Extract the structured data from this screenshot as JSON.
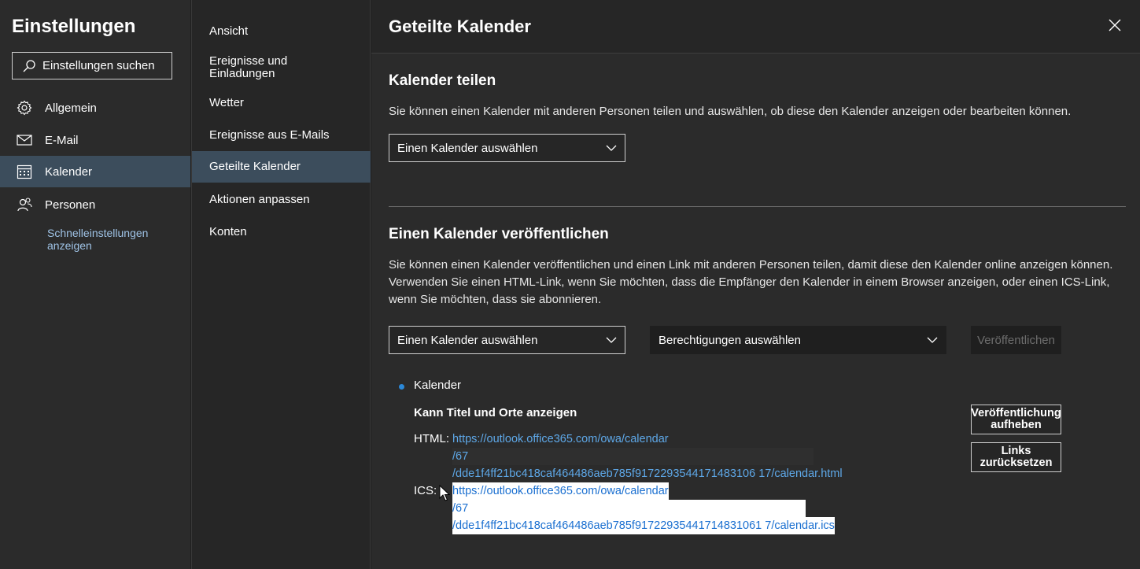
{
  "sidebar": {
    "title": "Einstellungen",
    "search_placeholder": "Einstellungen suchen",
    "items": [
      {
        "label": "Allgemein",
        "icon": "gear-icon"
      },
      {
        "label": "E-Mail",
        "icon": "mail-icon"
      },
      {
        "label": "Kalender",
        "icon": "calendar-icon"
      },
      {
        "label": "Personen",
        "icon": "people-icon"
      }
    ],
    "quick_settings": "Schnelleinstellungen anzeigen"
  },
  "subnav": {
    "items": [
      {
        "label": "Ansicht"
      },
      {
        "label": "Ereignisse und Einladungen"
      },
      {
        "label": "Wetter"
      },
      {
        "label": "Ereignisse aus E-Mails"
      },
      {
        "label": "Geteilte Kalender"
      },
      {
        "label": "Aktionen anpassen"
      },
      {
        "label": "Konten"
      }
    ]
  },
  "panel": {
    "title": "Geteilte Kalender",
    "share": {
      "title": "Kalender teilen",
      "description": "Sie können einen Kalender mit anderen Personen teilen und auswählen, ob diese den Kalender anzeigen oder bearbeiten können.",
      "calendar_select": "Einen Kalender auswählen"
    },
    "publish": {
      "title": "Einen Kalender veröffentlichen",
      "description": "Sie können einen Kalender veröffentlichen und einen Link mit anderen Personen teilen, damit diese den Kalender online anzeigen können. Verwenden Sie einen HTML-Link, wenn Sie möchten, dass die Empfänger den Kalender in einem Browser anzeigen, oder einen ICS-Link, wenn Sie möchten, dass sie abonnieren.",
      "calendar_select": "Einen Kalender auswählen",
      "permissions_select": "Berechtigungen auswählen",
      "publish_button": "Veröffentlichen"
    },
    "published": {
      "calendar_name": "Kalender",
      "permission": "Kann Titel und Orte anzeigen",
      "html_label": "HTML:",
      "html_lines": [
        "https://outlook.office365.com/owa/calendar",
        "/67",
        "/dde1f4ff21bc418caf464486aeb785f9172293544171483106 17/calendar.html"
      ],
      "ics_label": "ICS:",
      "ics_lines": [
        "https://outlook.office365.com/owa/calendar",
        "/67",
        "/dde1f4ff21bc418caf464486aeb785f91722935441714831061 7/calendar.ics"
      ],
      "unpublish_button": "Veröffentlichung aufheben",
      "reset_button": "Links zurücksetzen"
    }
  },
  "colors": {
    "accent": "#2b88d8",
    "link": "#5ea8e8",
    "active_bg": "#3c4d5c"
  }
}
